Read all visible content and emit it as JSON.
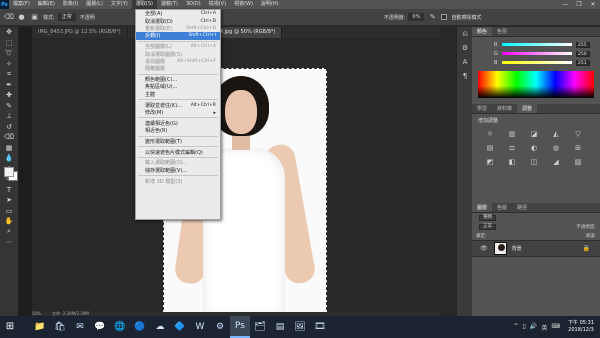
{
  "app": {
    "logo": "Ps"
  },
  "menubar": [
    "檔案(F)",
    "編輯(E)",
    "影像(I)",
    "圖層(L)",
    "文字(Y)",
    "選取(S)",
    "濾鏡(T)",
    "3D(D)",
    "檢視(V)",
    "視窗(W)",
    "說明(H)"
  ],
  "menubar_active_index": 5,
  "window_controls": [
    "—",
    "❐",
    "✕"
  ],
  "options": {
    "style_label": "樣式:",
    "style_value": "正常",
    "inconsistent_label": "不透明",
    "opacity_label": "不透明度:",
    "opacity_value": "0%",
    "checkbox_label": "自動擦除模式"
  },
  "tabs": [
    "IMG_8453.JPG @ 12.5% (RGB/8*)",
    "06-04.jpg @ 50% (RGB/8*)"
  ],
  "status": {
    "zoom": "50%",
    "doc": "文件: 2.29M/2.29M"
  },
  "dropdown": [
    {
      "label": "全部(A)",
      "shortcut": "Ctrl+A",
      "state": "normal"
    },
    {
      "label": "取消選取(D)",
      "shortcut": "Ctrl+D",
      "state": "normal"
    },
    {
      "label": "重新選取(E)",
      "shortcut": "Shift+Ctrl+D",
      "state": "disabled"
    },
    {
      "label": "反轉(I)",
      "shortcut": "Shift+Ctrl+I",
      "state": "highlight"
    },
    {
      "sep": true
    },
    {
      "label": "全部圖層(L)",
      "shortcut": "Alt+Ctrl+A",
      "state": "disabled"
    },
    {
      "label": "取消選取圖層(S)",
      "shortcut": "",
      "state": "disabled"
    },
    {
      "label": "尋找圖層",
      "shortcut": "Alt+Shift+Ctrl+F",
      "state": "disabled"
    },
    {
      "label": "隔離圖層",
      "shortcut": "",
      "state": "disabled"
    },
    {
      "sep": true
    },
    {
      "label": "顏色範圍(C)...",
      "shortcut": "",
      "state": "normal"
    },
    {
      "label": "焦點區域(U)...",
      "shortcut": "",
      "state": "normal"
    },
    {
      "label": "主體",
      "shortcut": "",
      "state": "normal"
    },
    {
      "sep": true
    },
    {
      "label": "選取並遮住(K)...",
      "shortcut": "Alt+Ctrl+R",
      "state": "normal"
    },
    {
      "label": "修改(M)",
      "shortcut": "",
      "state": "normal",
      "arrow": "▸"
    },
    {
      "sep": true
    },
    {
      "label": "連續相近色(G)",
      "shortcut": "",
      "state": "normal"
    },
    {
      "label": "相近色(R)",
      "shortcut": "",
      "state": "normal"
    },
    {
      "sep": true
    },
    {
      "label": "變形選取範圍(T)",
      "shortcut": "",
      "state": "normal"
    },
    {
      "sep": true
    },
    {
      "label": "以快速遮色片模式編輯(Q)",
      "shortcut": "",
      "state": "normal"
    },
    {
      "sep": true
    },
    {
      "label": "載入選取範圍(O)...",
      "shortcut": "",
      "state": "disabled"
    },
    {
      "label": "儲存選取範圍(V)...",
      "shortcut": "",
      "state": "normal"
    },
    {
      "sep": true
    },
    {
      "label": "新增 3D 模型(3)",
      "shortcut": "",
      "state": "disabled"
    }
  ],
  "color_panel": {
    "tabs": [
      "顏色",
      "色票"
    ],
    "rows": [
      {
        "ch": "R",
        "value": "255",
        "gradient": "linear-gradient(to right,#00ffff,#ffffff)"
      },
      {
        "ch": "G",
        "value": "250",
        "gradient": "linear-gradient(to right,#ff00ff,#ffffff)"
      },
      {
        "ch": "B",
        "value": "251",
        "gradient": "linear-gradient(to right,#ffff00,#ffffff)"
      }
    ]
  },
  "adjust_panel": {
    "tabs": [
      "學習",
      "資料庫",
      "調整"
    ],
    "title": "增加調整",
    "icons": [
      "☼",
      "▥",
      "◪",
      "◭",
      "▽",
      "▤",
      "⚖",
      "◐",
      "◍",
      "⊞",
      "◩",
      "◧",
      "◫",
      "◢",
      "▨"
    ]
  },
  "layers_panel": {
    "tabs": [
      "圖層",
      "色版",
      "路徑"
    ],
    "kind_label": "種類",
    "mode_value": "正常",
    "opacity_label": "不透明度:",
    "lock_label": "鎖定:",
    "fill_label": "填滿:",
    "layer_name": "背景"
  },
  "taskbar": {
    "apps": [
      "📁",
      "🛍",
      "✉",
      "💬",
      "🌐",
      "🔵",
      "☁",
      "🔷",
      "W",
      "⚙",
      "Ps",
      "🗂",
      "▤",
      "🖼",
      "🎞"
    ],
    "active_index": 10,
    "tray": [
      "^",
      "▯",
      "🔊",
      "英",
      "⌨"
    ],
    "time": "下午 05:31",
    "date": "2018/12/3"
  }
}
